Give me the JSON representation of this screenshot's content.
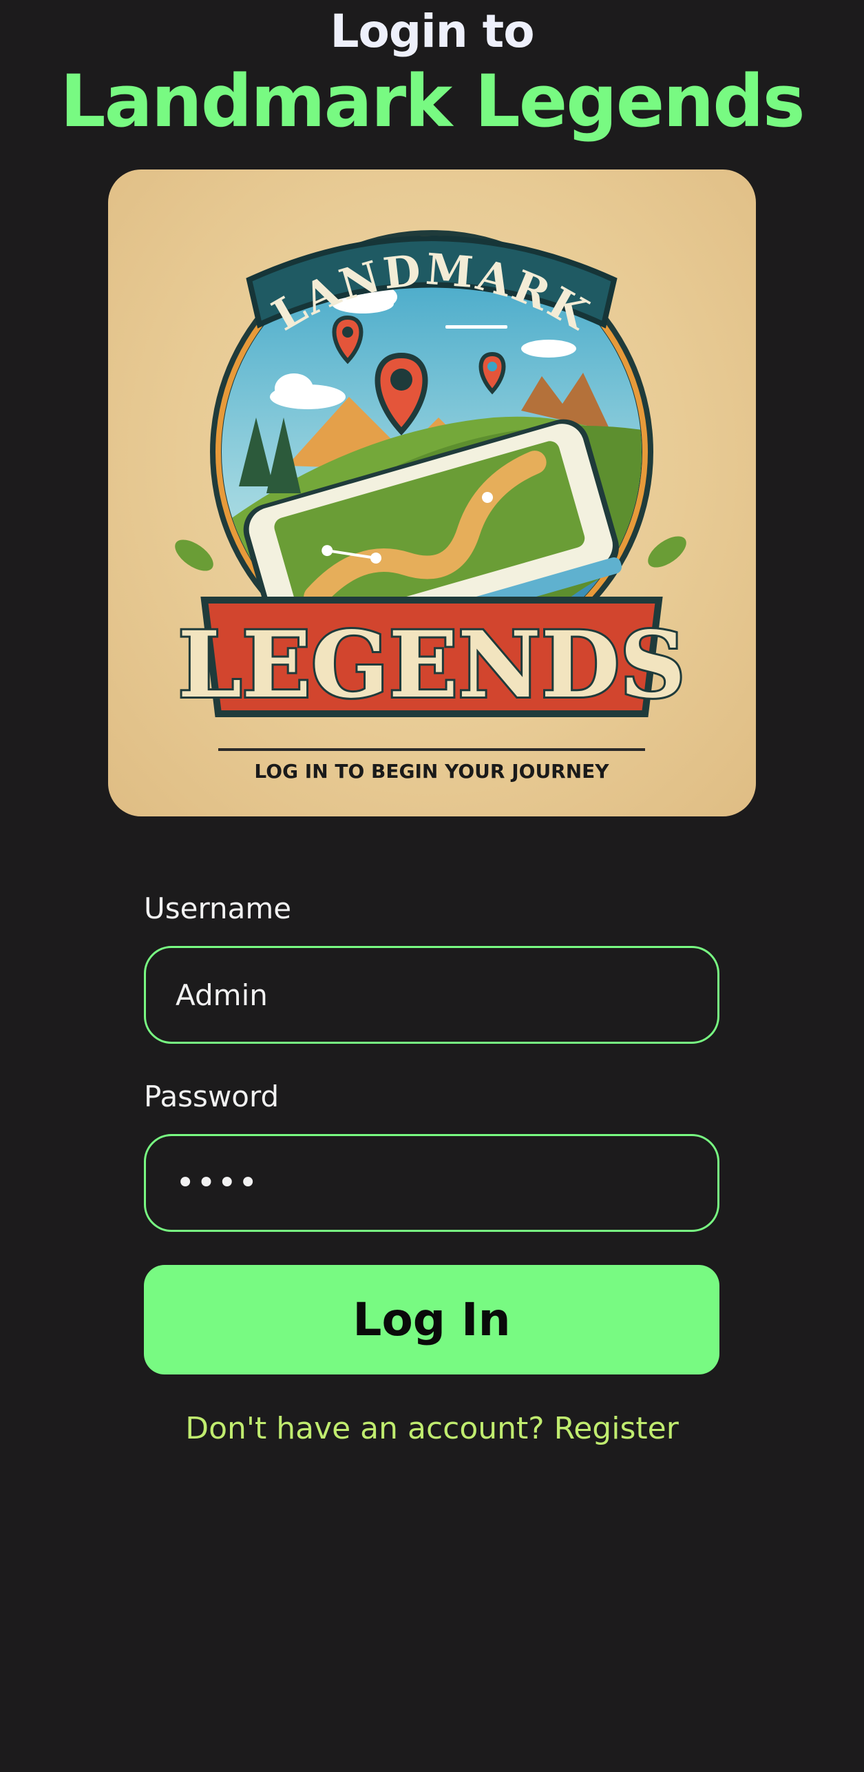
{
  "header": {
    "subtitle": "Login to",
    "title": "Landmark Legends"
  },
  "logo": {
    "top_text": "LANDMARK",
    "banner_text": "LEGENDS",
    "tagline": "LOG IN TO BEGIN YOUR JOURNEY"
  },
  "form": {
    "username_label": "Username",
    "username_value": "Admin",
    "password_label": "Password",
    "password_value": "••••",
    "login_label": "Log In",
    "register_text": "Don't have an account? Register"
  },
  "colors": {
    "background": "#1c1b1c",
    "accent": "#78fa82",
    "link": "#c0ec6f"
  }
}
